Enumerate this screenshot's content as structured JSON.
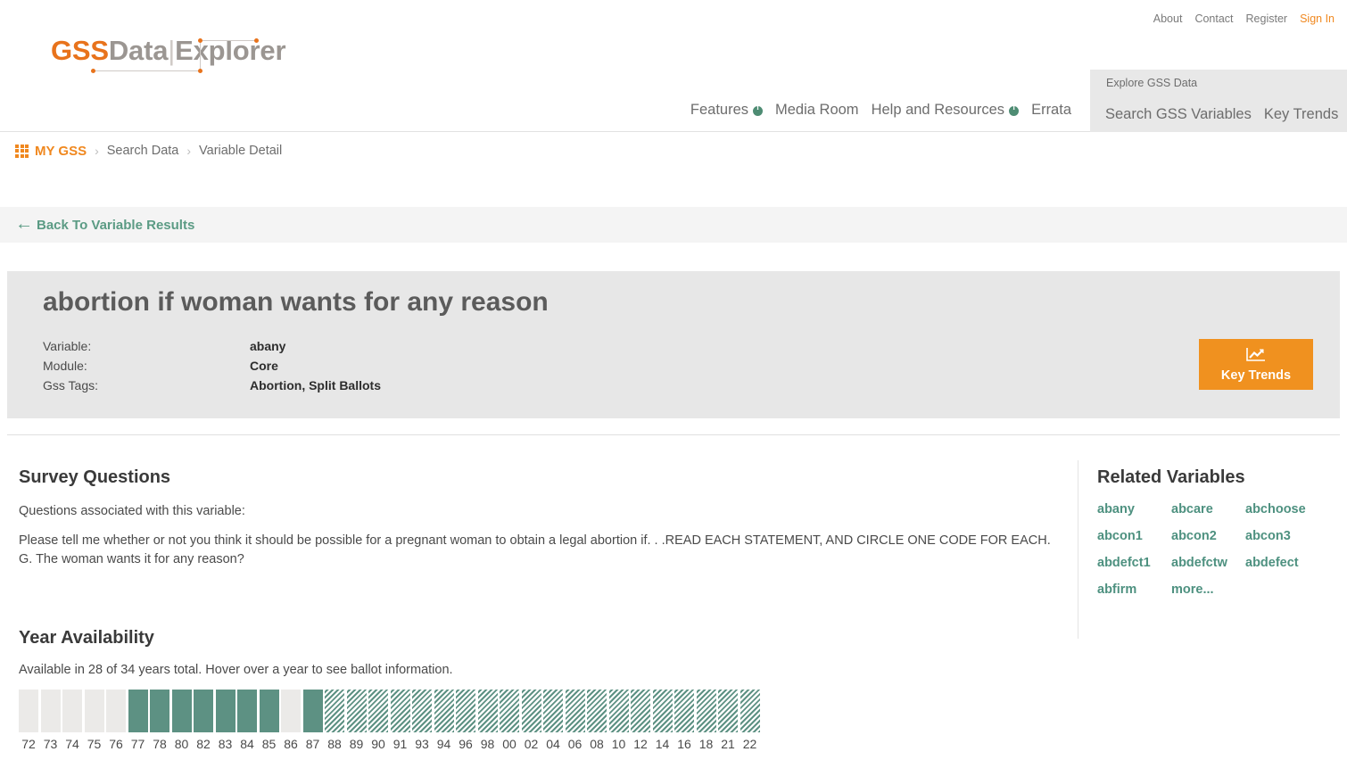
{
  "utility_links": [
    {
      "label": "About",
      "style": "muted"
    },
    {
      "label": "Contact",
      "style": "muted"
    },
    {
      "label": "Register",
      "style": "muted"
    },
    {
      "label": "Sign In",
      "style": "accent"
    }
  ],
  "logo": {
    "part1": "GSS",
    "part2": "Data",
    "divider": "|",
    "part3": "Explorer"
  },
  "nav": {
    "items": [
      {
        "label": "Features",
        "info": true
      },
      {
        "label": "Media Room",
        "info": false
      },
      {
        "label": "Help and Resources",
        "info": true
      },
      {
        "label": "Errata",
        "info": false
      }
    ],
    "dropdown": {
      "label": "Explore GSS Data",
      "items": [
        {
          "label": "Search GSS Variables"
        },
        {
          "label": "Key Trends"
        }
      ]
    }
  },
  "breadcrumb": {
    "home": "MY GSS",
    "separator": "›",
    "items": [
      "Search Data",
      "Variable Detail"
    ]
  },
  "back_bar": {
    "arrow": "←",
    "label": "Back To Variable Results"
  },
  "hero": {
    "title": "abortion if woman wants for any reason",
    "meta": [
      {
        "key": "Variable:",
        "value": "abany"
      },
      {
        "key": "Module:",
        "value": "Core"
      },
      {
        "key": "Gss Tags:",
        "value": "Abortion, Split Ballots"
      }
    ],
    "key_trends_button": {
      "label": "Key Trends",
      "icon": "chart-line-icon",
      "color": "#f0911f"
    }
  },
  "survey_questions": {
    "heading": "Survey Questions",
    "intro": "Questions associated with this variable:",
    "body": "Please tell me whether or not you think it should be possible for a pregnant woman to obtain a legal abortion if. . .READ EACH STATEMENT, AND CIRCLE ONE CODE FOR EACH.\nG. The woman wants it for any reason?"
  },
  "related_variables": {
    "heading": "Related Variables",
    "links": [
      "abany",
      "abcare",
      "abchoose",
      "abcon1",
      "abcon2",
      "abcon3",
      "abdefct1",
      "abdefctw",
      "abdefect",
      "abfirm",
      "more..."
    ]
  },
  "year_availability": {
    "heading": "Year Availability",
    "note": "Available in 28 of 34 years total. Hover over a year to see ballot information.",
    "available_count": 28,
    "total_count": 34,
    "colors": {
      "solid": "#5d9183",
      "empty": "#ebeae8",
      "striped": "#5d9183"
    },
    "years": [
      {
        "label": "72",
        "state": "empty"
      },
      {
        "label": "73",
        "state": "empty"
      },
      {
        "label": "74",
        "state": "empty"
      },
      {
        "label": "75",
        "state": "empty"
      },
      {
        "label": "76",
        "state": "empty"
      },
      {
        "label": "77",
        "state": "solid"
      },
      {
        "label": "78",
        "state": "solid"
      },
      {
        "label": "80",
        "state": "solid"
      },
      {
        "label": "82",
        "state": "solid"
      },
      {
        "label": "83",
        "state": "solid"
      },
      {
        "label": "84",
        "state": "solid"
      },
      {
        "label": "85",
        "state": "solid"
      },
      {
        "label": "86",
        "state": "empty"
      },
      {
        "label": "87",
        "state": "solid"
      },
      {
        "label": "88",
        "state": "striped"
      },
      {
        "label": "89",
        "state": "striped"
      },
      {
        "label": "90",
        "state": "striped"
      },
      {
        "label": "91",
        "state": "striped"
      },
      {
        "label": "93",
        "state": "striped"
      },
      {
        "label": "94",
        "state": "striped"
      },
      {
        "label": "96",
        "state": "striped"
      },
      {
        "label": "98",
        "state": "striped"
      },
      {
        "label": "00",
        "state": "striped"
      },
      {
        "label": "02",
        "state": "striped"
      },
      {
        "label": "04",
        "state": "striped"
      },
      {
        "label": "06",
        "state": "striped"
      },
      {
        "label": "08",
        "state": "striped"
      },
      {
        "label": "10",
        "state": "striped"
      },
      {
        "label": "12",
        "state": "striped"
      },
      {
        "label": "14",
        "state": "striped"
      },
      {
        "label": "16",
        "state": "striped"
      },
      {
        "label": "18",
        "state": "striped"
      },
      {
        "label": "21",
        "state": "striped"
      },
      {
        "label": "22",
        "state": "striped"
      }
    ]
  }
}
